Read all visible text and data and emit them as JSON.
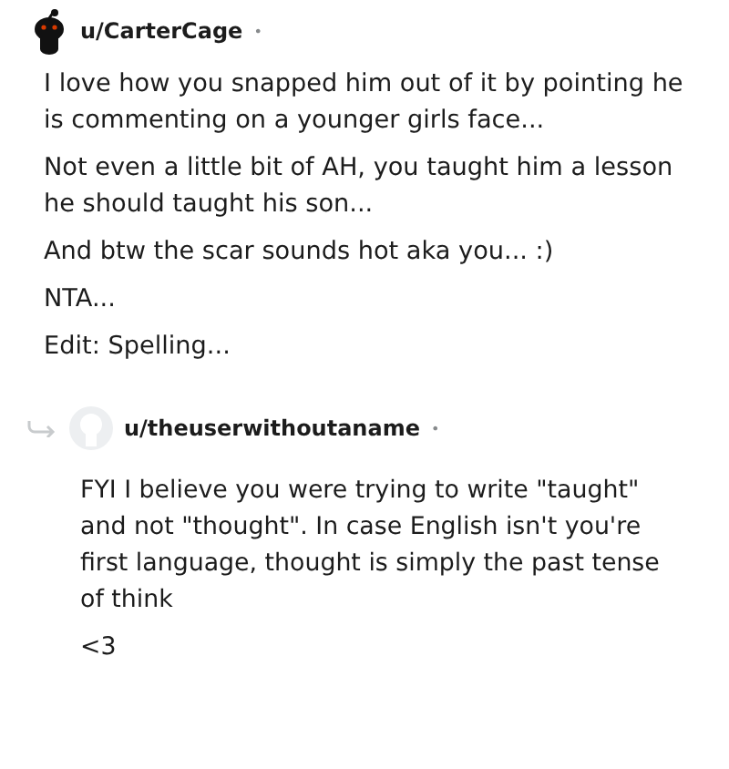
{
  "comments": [
    {
      "username": "u/CarterCage",
      "separator": "•",
      "kind": "comment",
      "paragraphs": [
        "I love how you snapped him out of it by pointing he is commenting on a younger girls face...",
        "Not even a little bit of AH, you taught him a lesson he should taught his son...",
        "And btw the scar sounds hot aka you... :)",
        "NTA...",
        "Edit: Spelling..."
      ]
    },
    {
      "username": "u/theuserwithoutaname",
      "separator": "•",
      "kind": "reply",
      "paragraphs": [
        "FYI I believe you were trying to write \"taught\" and not \"thought\". In case English isn't you're first language, thought is simply the past tense of think",
        "<3"
      ]
    }
  ]
}
